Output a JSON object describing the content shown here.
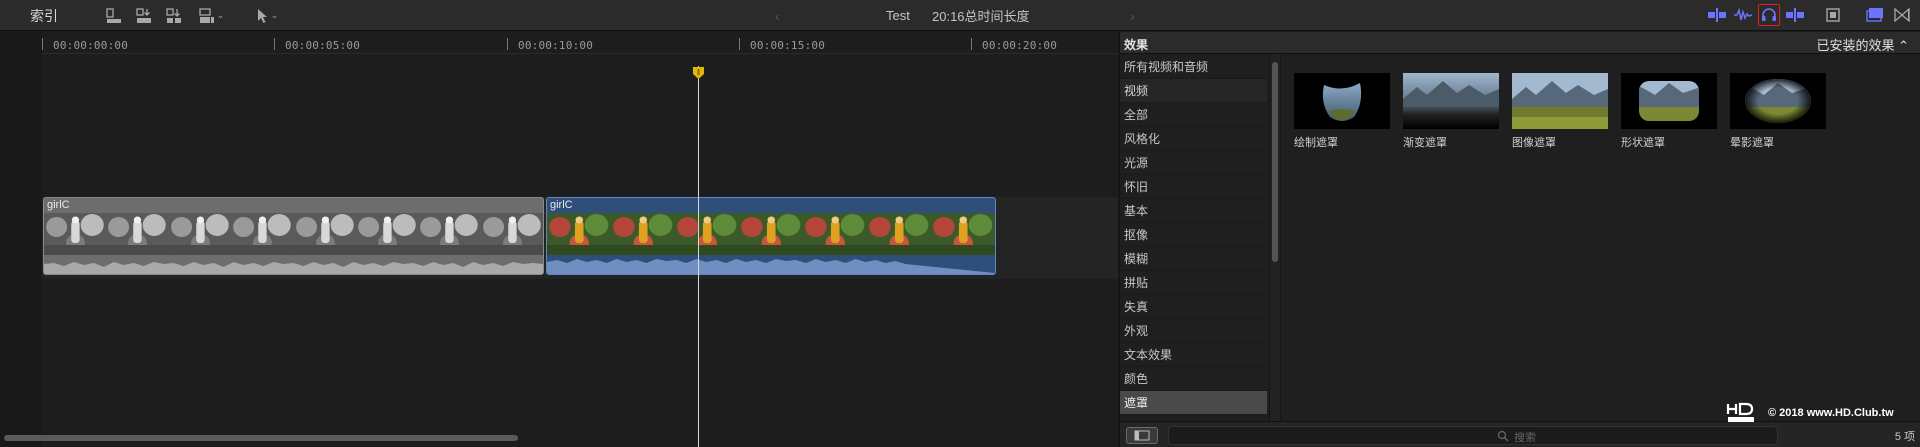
{
  "toolbar": {
    "index_label": "索引",
    "prev_glyph": "‹",
    "next_glyph": "›",
    "project_name": "Test",
    "duration_text": "20:16总时间长度",
    "icons": [
      "clip-appearance-icon",
      "connect-clip-icon",
      "insert-clip-icon",
      "append-clip-icon",
      "select-tool-icon",
      "skimming-icon",
      "audio-skimming-icon",
      "solo-headphone-icon",
      "snapping-icon",
      "clip-appearance-film-icon",
      "browser-toggle-icon",
      "inspector-toggle-icon"
    ],
    "accent": "#6b73ff",
    "highlight": "#dd2222"
  },
  "timeline": {
    "ruler": [
      "00:00:00:00",
      "00:00:05:00",
      "00:00:10:00",
      "00:00:15:00",
      "00:00:20:00"
    ],
    "clips": [
      {
        "title": "girlC",
        "style": "black-white"
      },
      {
        "title": "girlC",
        "style": "color"
      }
    ]
  },
  "effects": {
    "header_title": "效果",
    "installed_label": "已安装的效果 ⌃",
    "categories": [
      {
        "label": "所有视频和音频",
        "kind": "item"
      },
      {
        "label": "视频",
        "kind": "group"
      },
      {
        "label": "全部",
        "kind": "item"
      },
      {
        "label": "风格化",
        "kind": "item"
      },
      {
        "label": "光源",
        "kind": "item"
      },
      {
        "label": "怀旧",
        "kind": "item"
      },
      {
        "label": "基本",
        "kind": "item"
      },
      {
        "label": "抠像",
        "kind": "item"
      },
      {
        "label": "模糊",
        "kind": "item"
      },
      {
        "label": "拼贴",
        "kind": "item"
      },
      {
        "label": "失真",
        "kind": "item"
      },
      {
        "label": "外观",
        "kind": "item"
      },
      {
        "label": "文本效果",
        "kind": "item"
      },
      {
        "label": "颜色",
        "kind": "item"
      },
      {
        "label": "遮罩",
        "kind": "selected"
      }
    ],
    "items": [
      {
        "label": "绘制遮罩",
        "icon": "draw-mask-thumbnail"
      },
      {
        "label": "渐变遮罩",
        "icon": "gradient-mask-thumbnail"
      },
      {
        "label": "图像遮罩",
        "icon": "image-mask-thumbnail"
      },
      {
        "label": "形状遮罩",
        "icon": "shape-mask-thumbnail"
      },
      {
        "label": "晕影遮罩",
        "icon": "vignette-mask-thumbnail"
      }
    ],
    "search_placeholder": "搜索",
    "item_count": "5 项"
  },
  "watermark": {
    "text": "© 2018 www.HD.Club.tw"
  }
}
